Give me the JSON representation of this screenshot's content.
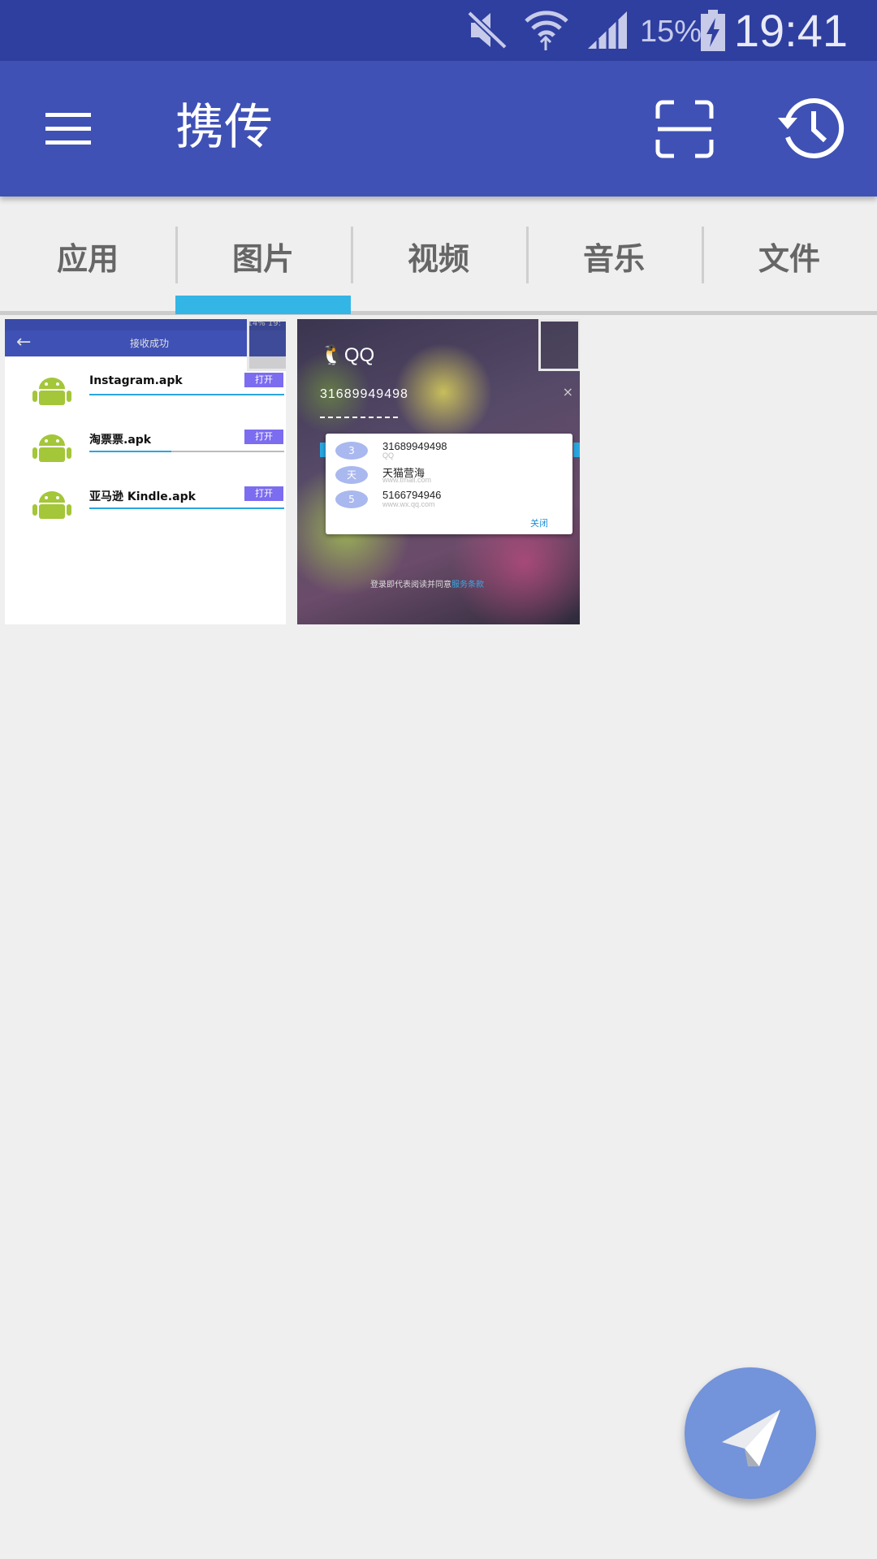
{
  "status_bar": {
    "battery_percent": "15%",
    "time": "19:41",
    "icons": [
      "mute-icon",
      "wifi-icon",
      "signal-icon",
      "battery-charging-icon"
    ]
  },
  "app_bar": {
    "title": "携传",
    "menu_icon": "menu-icon",
    "scan_icon": "scan-icon",
    "history_icon": "history-icon"
  },
  "tabs": [
    {
      "label": "应用"
    },
    {
      "label": "图片",
      "selected": true
    },
    {
      "label": "视频"
    },
    {
      "label": "音乐"
    },
    {
      "label": "文件"
    }
  ],
  "images": [
    {
      "status_text": "14%  19:",
      "header_title": "接收成功",
      "rows": [
        {
          "name": "Instagram.apk",
          "action": "打开",
          "progress": 1.0
        },
        {
          "name": "淘票票.apk",
          "action": "打开",
          "progress": 0.42
        },
        {
          "name": "亚马逊 Kindle.apk",
          "action": "打开",
          "progress": 1.0
        }
      ]
    },
    {
      "logo": "QQ",
      "account": "31689949498",
      "accounts": [
        {
          "avatar": "3",
          "name": "31689949498",
          "sub": "QQ"
        },
        {
          "avatar": "天",
          "name": "天猫营海",
          "sub": "www.tmall.com"
        },
        {
          "avatar": "5",
          "name": "5166794946",
          "sub": "www.wx.qq.com"
        }
      ],
      "popup_close": "关闭",
      "footer": "登录即代表阅读并同意",
      "footer_link": "服务条款"
    }
  ],
  "fab": {
    "icon": "send-paper-plane-icon"
  },
  "colors": {
    "status_bar": "#2f3fa0",
    "app_bar": "#3f51b5",
    "tab_indicator": "#33b5e5",
    "fab": "#7393da",
    "background": "#efefef"
  }
}
